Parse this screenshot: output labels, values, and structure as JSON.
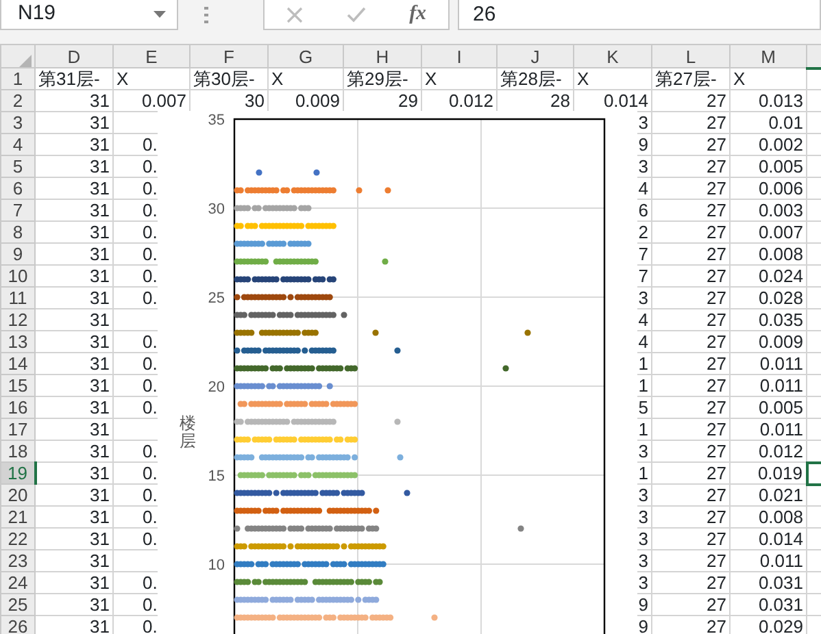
{
  "formula_bar": {
    "name_box": "N19",
    "function_label": "fx",
    "value": "26"
  },
  "columns": [
    {
      "label": "D",
      "selected": false
    },
    {
      "label": "E",
      "selected": false
    },
    {
      "label": "F",
      "selected": false
    },
    {
      "label": "G",
      "selected": false
    },
    {
      "label": "H",
      "selected": false
    },
    {
      "label": "I",
      "selected": false
    },
    {
      "label": "J",
      "selected": false
    },
    {
      "label": "K",
      "selected": false
    },
    {
      "label": "L",
      "selected": false
    },
    {
      "label": "M",
      "selected": false
    },
    {
      "selected": true
    }
  ],
  "rows": [
    {
      "number": "1",
      "selected": false,
      "cells": {
        "D": "第31层-",
        "E": "X",
        "F": "第30层-",
        "G": "X",
        "H": "第29层-",
        "I": "X",
        "J": "第28层-",
        "K": "X",
        "L": "第27层-",
        "M": "X"
      }
    },
    {
      "number": "2",
      "selected": false,
      "cells": {
        "D": "31",
        "E": "0.007",
        "F": "30",
        "G": "0.009",
        "H": "29",
        "I": "0.012",
        "J": "28",
        "K": "0.014",
        "L": "27",
        "M": "0.013"
      }
    },
    {
      "number": "3",
      "selected": false,
      "cells": {
        "D": "31",
        "K": "3",
        "L": "27",
        "M": "0.01"
      }
    },
    {
      "number": "4",
      "selected": false,
      "cells": {
        "D": "31",
        "E": "0.",
        "K": "9",
        "L": "27",
        "M": "0.002"
      }
    },
    {
      "number": "5",
      "selected": false,
      "cells": {
        "D": "31",
        "E": "0.",
        "K": "3",
        "L": "27",
        "M": "0.005"
      }
    },
    {
      "number": "6",
      "selected": false,
      "cells": {
        "D": "31",
        "E": "0.",
        "K": "4",
        "L": "27",
        "M": "0.006"
      }
    },
    {
      "number": "7",
      "selected": false,
      "cells": {
        "D": "31",
        "E": "0.",
        "K": "6",
        "L": "27",
        "M": "0.003"
      }
    },
    {
      "number": "8",
      "selected": false,
      "cells": {
        "D": "31",
        "E": "0.",
        "K": "2",
        "L": "27",
        "M": "0.007"
      }
    },
    {
      "number": "9",
      "selected": false,
      "cells": {
        "D": "31",
        "E": "0.",
        "K": "7",
        "L": "27",
        "M": "0.008"
      }
    },
    {
      "number": "10",
      "selected": false,
      "cells": {
        "D": "31",
        "E": "0.",
        "K": "7",
        "L": "27",
        "M": "0.024"
      }
    },
    {
      "number": "11",
      "selected": false,
      "cells": {
        "D": "31",
        "E": "0.",
        "K": "3",
        "L": "27",
        "M": "0.028"
      }
    },
    {
      "number": "12",
      "selected": false,
      "cells": {
        "D": "31",
        "K": "4",
        "L": "27",
        "M": "0.035"
      }
    },
    {
      "number": "13",
      "selected": false,
      "cells": {
        "D": "31",
        "E": "0.",
        "K": "4",
        "L": "27",
        "M": "0.009"
      }
    },
    {
      "number": "14",
      "selected": false,
      "cells": {
        "D": "31",
        "E": "0.",
        "K": "1",
        "L": "27",
        "M": "0.011"
      }
    },
    {
      "number": "15",
      "selected": false,
      "cells": {
        "D": "31",
        "E": "0.",
        "K": "1",
        "L": "27",
        "M": "0.011"
      }
    },
    {
      "number": "16",
      "selected": false,
      "cells": {
        "D": "31",
        "E": "0.",
        "K": "5",
        "L": "27",
        "M": "0.005"
      }
    },
    {
      "number": "17",
      "selected": false,
      "cells": {
        "D": "31",
        "K": "1",
        "L": "27",
        "M": "0.011"
      }
    },
    {
      "number": "18",
      "selected": false,
      "cells": {
        "D": "31",
        "E": "0.",
        "K": "3",
        "L": "27",
        "M": "0.012"
      }
    },
    {
      "number": "19",
      "selected": true,
      "cells": {
        "D": "31",
        "E": "0.",
        "K": "1",
        "L": "27",
        "M": "0.019"
      }
    },
    {
      "number": "20",
      "selected": false,
      "cells": {
        "D": "31",
        "E": "0.",
        "K": "3",
        "L": "27",
        "M": "0.021"
      }
    },
    {
      "number": "21",
      "selected": false,
      "cells": {
        "D": "31",
        "E": "0.",
        "K": "3",
        "L": "27",
        "M": "0.008"
      }
    },
    {
      "number": "22",
      "selected": false,
      "cells": {
        "D": "31",
        "E": "0.",
        "K": "3",
        "L": "27",
        "M": "0.014"
      }
    },
    {
      "number": "23",
      "selected": false,
      "cells": {
        "D": "31",
        "K": "3",
        "L": "27",
        "M": "0.011"
      }
    },
    {
      "number": "24",
      "selected": false,
      "cells": {
        "D": "31",
        "E": "0.",
        "K": "3",
        "L": "27",
        "M": "0.031"
      }
    },
    {
      "number": "25",
      "selected": false,
      "cells": {
        "D": "31",
        "E": "0.",
        "K": "9",
        "L": "27",
        "M": "0.031"
      }
    },
    {
      "number": "26",
      "selected": false,
      "cells": {
        "D": "31",
        "E": "0.",
        "K": "9",
        "L": "27",
        "M": "0.029"
      }
    }
  ],
  "chart": {
    "ylabel": "楼层",
    "yticks": [
      "35",
      "30",
      "25",
      "20",
      "15",
      "10"
    ],
    "series": [
      {
        "color": "#4472c4"
      },
      {
        "color": "#ed7d31"
      },
      {
        "color": "#a5a5a5"
      },
      {
        "color": "#ffc000"
      },
      {
        "color": "#5b9bd5"
      },
      {
        "color": "#70ad47"
      },
      {
        "color": "#264478"
      },
      {
        "color": "#9e480e"
      },
      {
        "color": "#636363"
      },
      {
        "color": "#997300"
      },
      {
        "color": "#255e91"
      },
      {
        "color": "#43682b"
      },
      {
        "color": "#698ed0"
      },
      {
        "color": "#f1975a"
      },
      {
        "color": "#b7b7b7"
      },
      {
        "color": "#ffcd33"
      },
      {
        "color": "#7cafdd"
      },
      {
        "color": "#8cc168"
      },
      {
        "color": "#335aa1"
      },
      {
        "color": "#d26012"
      },
      {
        "color": "#848484"
      },
      {
        "color": "#cc9a00"
      },
      {
        "color": "#327dc2"
      },
      {
        "color": "#5a8a39"
      },
      {
        "color": "#8faadc"
      },
      {
        "color": "#f4b183"
      }
    ]
  }
}
